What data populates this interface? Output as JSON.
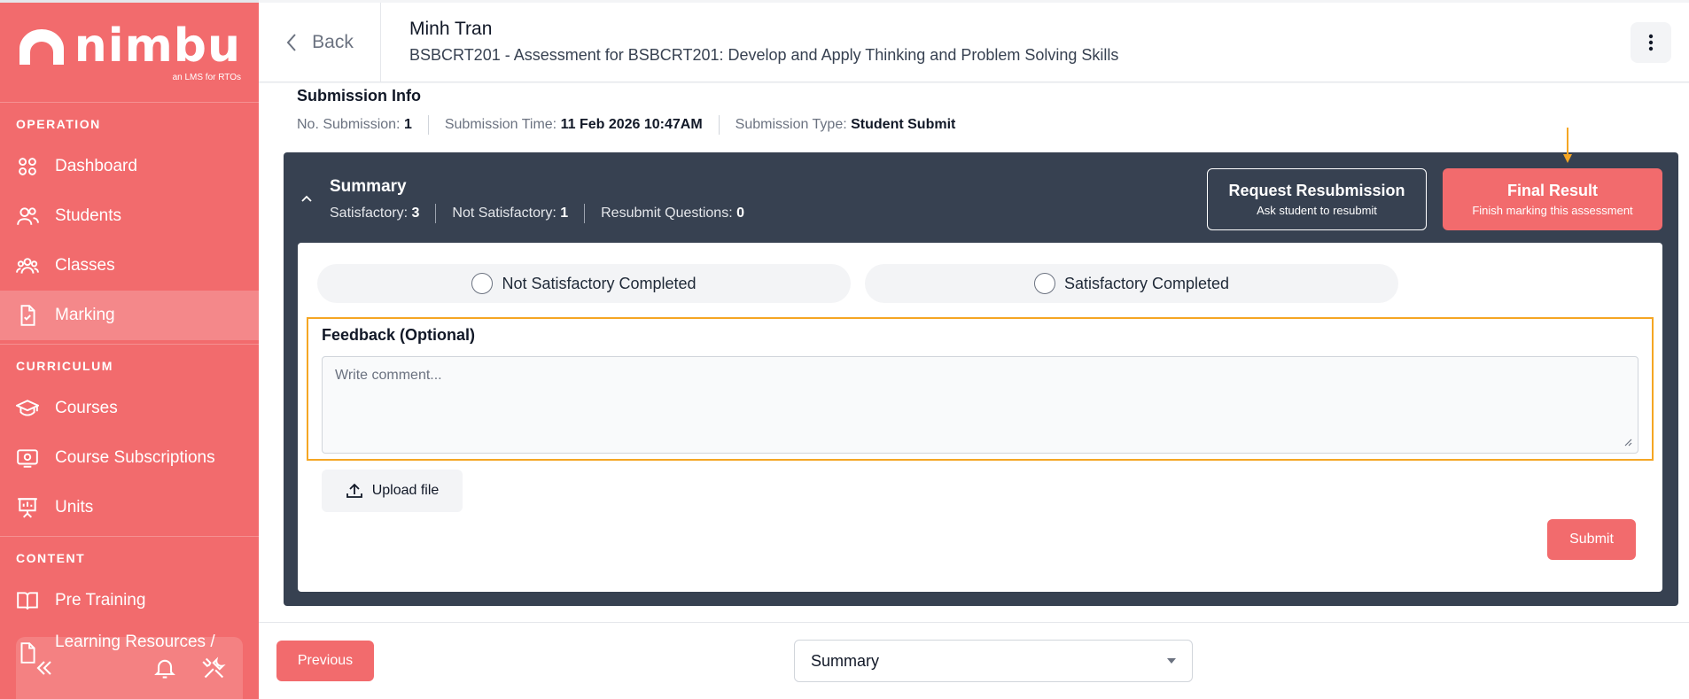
{
  "sidebar": {
    "logo_text": "nimbu",
    "logo_tagline": "an LMS for RTOs",
    "sections": {
      "operation": "OPERATION",
      "curriculum": "CURRICULUM",
      "content": "CONTENT"
    },
    "items": {
      "dashboard": "Dashboard",
      "students": "Students",
      "classes": "Classes",
      "marking": "Marking",
      "courses": "Courses",
      "course_subscriptions": "Course Subscriptions",
      "units": "Units",
      "pre_training": "Pre Training",
      "learning_resources": "Learning Resources /"
    }
  },
  "header": {
    "back_label": "Back",
    "student_name": "Minh Tran",
    "assessment_title": "BSBCRT201 - Assessment for BSBCRT201: Develop and Apply Thinking and Problem Solving Skills"
  },
  "submission_info": {
    "title": "Submission Info",
    "no_submission_label": "No. Submission:",
    "no_submission_value": "1",
    "time_label": "Submission Time:",
    "time_value": "11 Feb 2026 10:47AM",
    "type_label": "Submission Type:",
    "type_value": "Student Submit"
  },
  "summary": {
    "title": "Summary",
    "satisfactory_label": "Satisfactory:",
    "satisfactory_value": "3",
    "not_satisfactory_label": "Not Satisfactory:",
    "not_satisfactory_value": "1",
    "resubmit_label": "Resubmit Questions:",
    "resubmit_value": "0",
    "request_resubmission_title": "Request Resubmission",
    "request_resubmission_sub": "Ask student to resubmit",
    "final_result_title": "Final Result",
    "final_result_sub": "Finish marking this assessment"
  },
  "result_panel": {
    "option_not_satisfactory": "Not Satisfactory Completed",
    "option_satisfactory": "Satisfactory Completed",
    "feedback_label": "Feedback (Optional)",
    "comment_placeholder": "Write comment...",
    "upload_label": "Upload file",
    "submit_label": "Submit"
  },
  "footer": {
    "previous_label": "Previous",
    "section_select_value": "Summary"
  },
  "colors": {
    "brand": "#f26b6d",
    "summary_bg": "#374151",
    "highlight": "#f5a623"
  }
}
